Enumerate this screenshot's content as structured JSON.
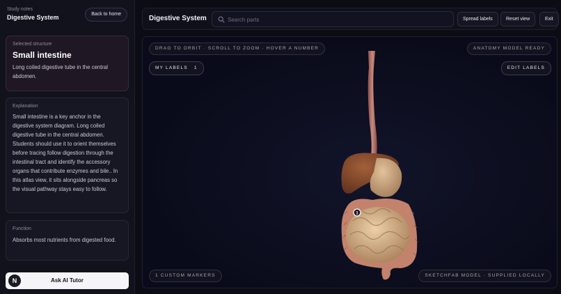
{
  "sidebar": {
    "kicker": "Study notes",
    "title": "Digestive System",
    "back_label": "Back to home",
    "selected": {
      "kicker": "Selected structure",
      "title": "Small intestine",
      "description": "Long coiled digestive tube in the central abdomen."
    },
    "explanation": {
      "kicker": "Explanation",
      "text": "Small intestine is a key anchor in the digestive system diagram. Long coiled digestive tube in the central abdomen. Students should use it to orient themselves before tracing follow digestion through the intestinal tract and identify the accessory organs that contribute enzymes and bile.. In this atlas view, it sits alongside pancreas so the visual pathway stays easy to follow."
    },
    "function": {
      "kicker": "Function",
      "text": "Absorbs most nutrients from digested food."
    },
    "ask_label": "Ask AI Tutor",
    "ask_logo": "N"
  },
  "topbar": {
    "title": "Digestive System",
    "search_placeholder": "Search parts",
    "search_value": "",
    "spread_label": "Spread labels",
    "reset_label": "Reset view",
    "exit_label": "Exit"
  },
  "viewer": {
    "hint": "Drag to orbit · Scroll to zoom · Hover a number",
    "status": "Anatomy model ready",
    "my_labels": "My labels",
    "my_labels_count": "1",
    "edit_labels": "Edit labels",
    "custom_markers": "1 custom markers",
    "source": "Sketchfab model · supplied locally",
    "marker_number": "1"
  },
  "colors": {
    "accent_selected_bg": "#1f1723",
    "viewer_bg": "#0a0b1a",
    "esophagus": "#b8706a",
    "liver": "#8a4a2e",
    "intestine": "#d8b48e",
    "colon": "#c98670"
  }
}
